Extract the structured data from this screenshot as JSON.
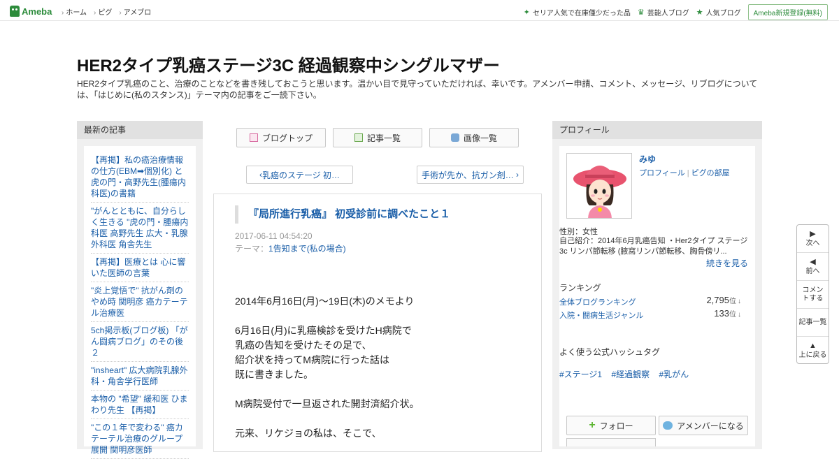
{
  "topbar": {
    "logo": "Ameba",
    "nav": [
      "ホーム",
      "ピグ",
      "アメブロ"
    ],
    "right_items": [
      {
        "icon": "sparkle-icon",
        "label": "セリア人気で在庫僅少だった品"
      },
      {
        "icon": "crown-icon",
        "label": "芸能人ブログ"
      },
      {
        "icon": "star-icon",
        "label": "人気ブログ"
      }
    ],
    "register": "Ameba新規登録(無料)"
  },
  "header": {
    "title": "HER2タイプ乳癌ステージ3C 経過観察中シングルマザー",
    "description": "HER2タイプ乳癌のこと、治療のことなどを書き残しておこうと思います。温かい目で見守っていただければ、幸いです。アメンバー申請、コメント、メッセージ、リブログについては、「はじめに(私のスタンス)」テーマ内の記事をご一読下さい。"
  },
  "left": {
    "heading": "最新の記事",
    "items": [
      "【再掲】私の癌治療情報の仕方(EBM➡個別化) と虎の門・高野先生(腫瘍内科医)の書籍",
      "\"がんとともに、自分らしく生きる \"虎の門・腫瘍内科医 高野先生 広大・乳腺外科医 角舎先生",
      "【再掲】医療とは 心に響いた医師の言葉",
      "\"炎上覚悟で\" 抗がん剤のやめ時 関明彦 癌カテーテル治療医",
      "5ch掲示板(ブログ板) 「がん闘病ブログ」のその後２",
      "\"insheart\" 広大病院乳腺外科・角舎学行医師",
      "本物の \"希望\" 緩和医 ひまわり先生 【再掲】",
      "\"この１年で変わる\" 癌カテーテル治療のグループ展開 関明彦医師"
    ]
  },
  "center": {
    "nav_buttons": [
      "ブログトップ",
      "記事一覧",
      "画像一覧"
    ],
    "prev": "乳癌のステージ 初…",
    "next": "手術が先か、抗ガン剤…",
    "article": {
      "title": "『局所進行乳癌』 初受診前に調べたこと１",
      "date": "2017-06-11 04:54:20",
      "theme_label": "テーマ：",
      "theme": "1告知まで(私の場合)",
      "body": [
        "2014年6月16日(月)～19日(木)のメモより",
        "",
        "6月16日(月)に乳癌検診を受けたH病院で",
        "乳癌の告知を受けたその足で、",
        "紹介状を持ってM病院に行った話は",
        "既に書きました。",
        "",
        "M病院受付で一旦返された開封済紹介状。",
        "",
        "元来、リケジョの私は、そこで、"
      ]
    }
  },
  "right": {
    "heading": "プロフィール",
    "name": "みゆ",
    "links": [
      "プロフィール",
      "ピグの部屋"
    ],
    "gender": "性別：女性",
    "intro": "自己紹介：2014年6月乳癌告知 ・Her2タイプ ステージ3c リンパ節転移 (腋窩リンパ節転移、胸骨傍リ...",
    "more": "続きを見る",
    "ranking_heading": "ランキング",
    "rankings": [
      {
        "label": "全体ブログランキング",
        "value": "2,795",
        "unit": "位",
        "arrow": "↓"
      },
      {
        "label": "入院・闘病生活ジャンル",
        "value": "133",
        "unit": "位",
        "arrow": "↓"
      }
    ],
    "hashtag_heading": "よく使う公式ハッシュタグ",
    "hashtags": [
      "#ステージ1",
      "#経過観察",
      "#乳がん"
    ],
    "follow": "フォロー",
    "member": "アメンバーになる"
  },
  "floatnav": [
    {
      "icon": "next-icon",
      "label": "次へ"
    },
    {
      "icon": "prev-icon",
      "label": "前へ"
    },
    {
      "icon": "",
      "label": "コメントする"
    },
    {
      "icon": "",
      "label": "記事一覧"
    },
    {
      "icon": "up-icon",
      "label": "上に戻る"
    }
  ]
}
